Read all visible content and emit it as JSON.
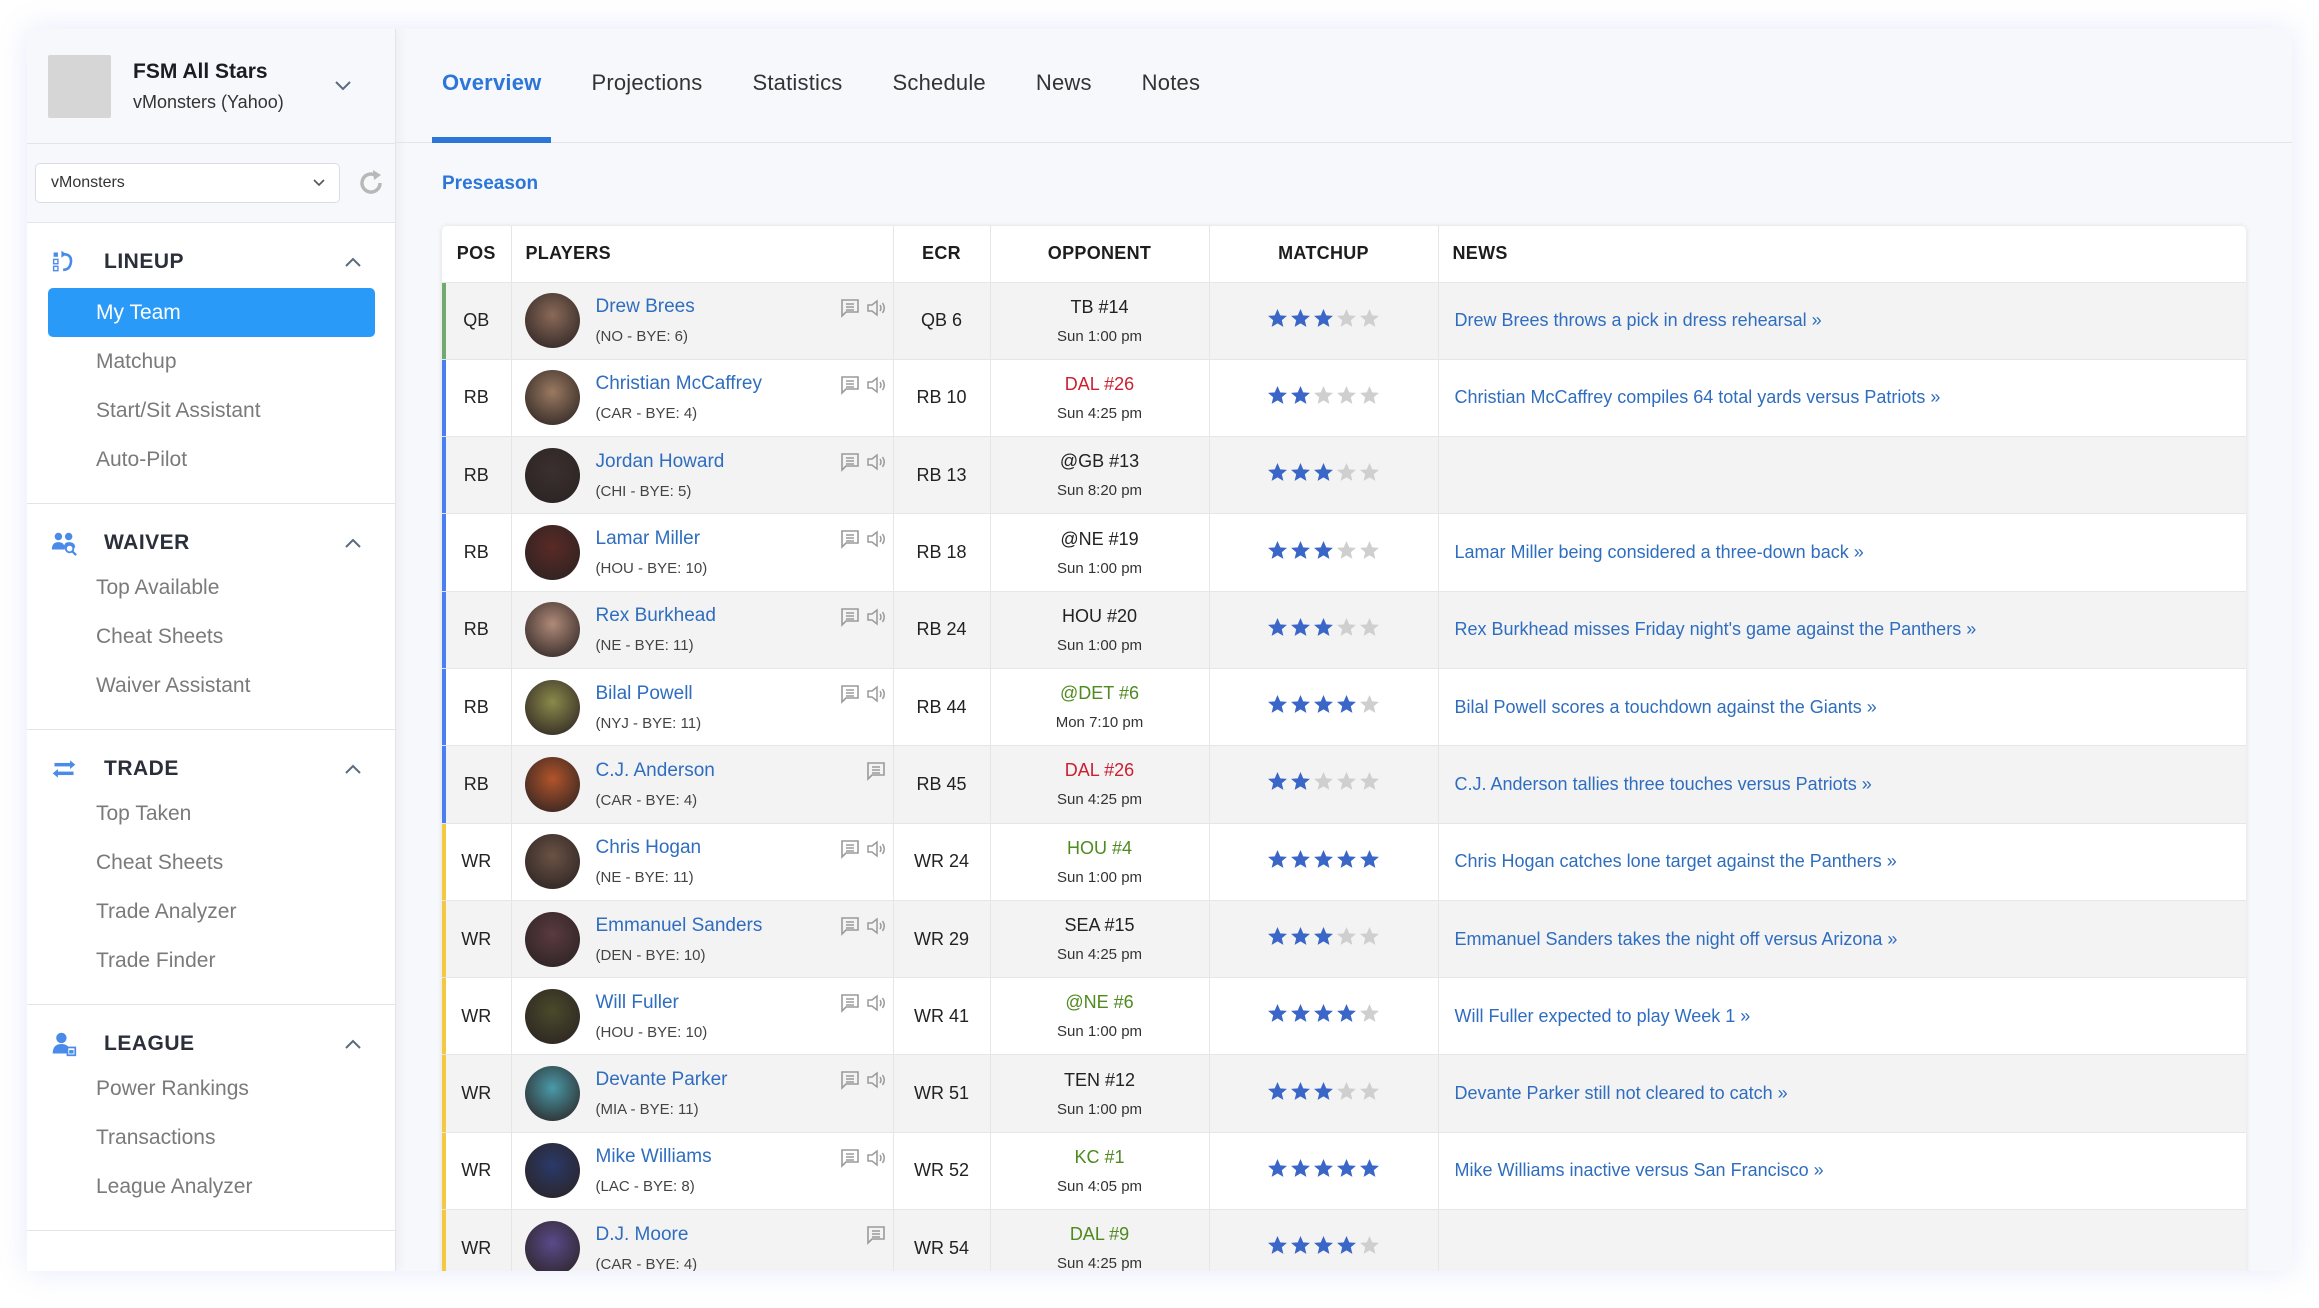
{
  "team": {
    "name": "FSM All Stars",
    "subtitle": "vMonsters (Yahoo)",
    "league_select": "vMonsters"
  },
  "sidebar": {
    "sections": [
      {
        "key": "lineup",
        "label": "LINEUP",
        "icon": "lineup-swap-icon",
        "items": [
          {
            "label": "My Team",
            "active": true
          },
          {
            "label": "Matchup"
          },
          {
            "label": "Start/Sit Assistant"
          },
          {
            "label": "Auto-Pilot"
          }
        ]
      },
      {
        "key": "waiver",
        "label": "WAIVER",
        "icon": "users-search-icon",
        "items": [
          {
            "label": "Top Available"
          },
          {
            "label": "Cheat Sheets"
          },
          {
            "label": "Waiver Assistant"
          }
        ]
      },
      {
        "key": "trade",
        "label": "TRADE",
        "icon": "trade-arrows-icon",
        "items": [
          {
            "label": "Top Taken"
          },
          {
            "label": "Cheat Sheets"
          },
          {
            "label": "Trade Analyzer"
          },
          {
            "label": "Trade Finder"
          }
        ]
      },
      {
        "key": "league",
        "label": "LEAGUE",
        "icon": "league-user-icon",
        "items": [
          {
            "label": "Power Rankings"
          },
          {
            "label": "Transactions"
          },
          {
            "label": "League Analyzer"
          }
        ]
      }
    ]
  },
  "tabs": [
    {
      "label": "Overview",
      "active": true
    },
    {
      "label": "Projections"
    },
    {
      "label": "Statistics"
    },
    {
      "label": "Schedule"
    },
    {
      "label": "News"
    },
    {
      "label": "Notes"
    }
  ],
  "section_label": "Preseason",
  "colors": {
    "accent": "#2b76d8",
    "active_nav": "#2a9af8",
    "link": "#2f6dbf",
    "star_on": "#3a66c8",
    "star_off": "#cfcfcf",
    "opp_good": "#4f8a1f",
    "opp_bad": "#cc1f2f",
    "opp_neutral": "#222222",
    "pos_QB": "#72a96c",
    "pos_RB": "#4a7ef5",
    "pos_WR": "#f5c842"
  },
  "table": {
    "headers": {
      "pos": "POS",
      "players": "PLAYERS",
      "ecr": "ECR",
      "opponent": "OPPONENT",
      "matchup": "MATCHUP",
      "news": "NEWS"
    },
    "rows": [
      {
        "pos": "QB",
        "name": "Drew Brees",
        "meta": "(NO - BYE: 6)",
        "note": true,
        "audio": true,
        "ecr": "QB 6",
        "opp": "TB #14",
        "opp_tone": "neutral",
        "time": "Sun 1:00 pm",
        "stars": 3,
        "news": "Drew Brees throws a pick in dress rehearsal »",
        "avatar_color": "#8a6a58"
      },
      {
        "pos": "RB",
        "name": "Christian McCaffrey",
        "meta": "(CAR - BYE: 4)",
        "note": true,
        "audio": true,
        "ecr": "RB 10",
        "opp": "DAL #26",
        "opp_tone": "bad",
        "time": "Sun 4:25 pm",
        "stars": 2,
        "news": "Christian McCaffrey compiles 64 total yards versus Patriots »",
        "avatar_color": "#9a7a60"
      },
      {
        "pos": "RB",
        "name": "Jordan Howard",
        "meta": "(CHI - BYE: 5)",
        "note": true,
        "audio": true,
        "ecr": "RB 13",
        "opp": "@GB #13",
        "opp_tone": "neutral",
        "time": "Sun 8:20 pm",
        "stars": 3,
        "news": "",
        "avatar_color": "#3b3030"
      },
      {
        "pos": "RB",
        "name": "Lamar Miller",
        "meta": "(HOU - BYE: 10)",
        "note": true,
        "audio": true,
        "ecr": "RB 18",
        "opp": "@NE #19",
        "opp_tone": "neutral",
        "time": "Sun 1:00 pm",
        "stars": 3,
        "news": "Lamar Miller being considered a three-down back »",
        "avatar_color": "#5a2a25"
      },
      {
        "pos": "RB",
        "name": "Rex Burkhead",
        "meta": "(NE - BYE: 11)",
        "note": true,
        "audio": true,
        "ecr": "RB 24",
        "opp": "HOU #20",
        "opp_tone": "neutral",
        "time": "Sun 1:00 pm",
        "stars": 3,
        "news": "Rex Burkhead misses Friday night's game against the Panthers »",
        "avatar_color": "#b08a78"
      },
      {
        "pos": "RB",
        "name": "Bilal Powell",
        "meta": "(NYJ - BYE: 11)",
        "note": true,
        "audio": true,
        "ecr": "RB 44",
        "opp": "@DET #6",
        "opp_tone": "good",
        "time": "Mon 7:10 pm",
        "stars": 4,
        "news": "Bilal Powell scores a touchdown against the Giants »",
        "avatar_color": "#8b8a4a"
      },
      {
        "pos": "RB",
        "name": "C.J. Anderson",
        "meta": "(CAR - BYE: 4)",
        "note": true,
        "audio": false,
        "ecr": "RB 45",
        "opp": "DAL #26",
        "opp_tone": "bad",
        "time": "Sun 4:25 pm",
        "stars": 2,
        "news": "C.J. Anderson tallies three touches versus Patriots »",
        "avatar_color": "#b2542a"
      },
      {
        "pos": "WR",
        "name": "Chris Hogan",
        "meta": "(NE - BYE: 11)",
        "note": true,
        "audio": true,
        "ecr": "WR 24",
        "opp": "HOU #4",
        "opp_tone": "good",
        "time": "Sun 1:00 pm",
        "stars": 5,
        "news": "Chris Hogan catches lone target against the Panthers »",
        "avatar_color": "#6a5244"
      },
      {
        "pos": "WR",
        "name": "Emmanuel Sanders",
        "meta": "(DEN - BYE: 10)",
        "note": true,
        "audio": true,
        "ecr": "WR 29",
        "opp": "SEA #15",
        "opp_tone": "neutral",
        "time": "Sun 4:25 pm",
        "stars": 3,
        "news": "Emmanuel Sanders takes the night off versus Arizona »",
        "avatar_color": "#5a3a40"
      },
      {
        "pos": "WR",
        "name": "Will Fuller",
        "meta": "(HOU - BYE: 10)",
        "note": true,
        "audio": true,
        "ecr": "WR 41",
        "opp": "@NE #6",
        "opp_tone": "good",
        "time": "Sun 1:00 pm",
        "stars": 4,
        "news": "Will Fuller expected to play Week 1 »",
        "avatar_color": "#4a4a2a"
      },
      {
        "pos": "WR",
        "name": "Devante Parker",
        "meta": "(MIA - BYE: 11)",
        "note": true,
        "audio": true,
        "ecr": "WR 51",
        "opp": "TEN #12",
        "opp_tone": "neutral",
        "time": "Sun 1:00 pm",
        "stars": 3,
        "news": "Devante Parker still not cleared to catch »",
        "avatar_color": "#4a9aa8"
      },
      {
        "pos": "WR",
        "name": "Mike Williams",
        "meta": "(LAC - BYE: 8)",
        "note": true,
        "audio": true,
        "ecr": "WR 52",
        "opp": "KC #1",
        "opp_tone": "good",
        "time": "Sun 4:05 pm",
        "stars": 5,
        "news": "Mike Williams inactive versus San Francisco »",
        "avatar_color": "#2a3a6a"
      },
      {
        "pos": "WR",
        "name": "D.J. Moore",
        "meta": "(CAR - BYE: 4)",
        "note": true,
        "audio": false,
        "ecr": "WR 54",
        "opp": "DAL #9",
        "opp_tone": "good",
        "time": "Sun 4:25 pm",
        "stars": 4,
        "news": "",
        "avatar_color": "#5a4a8a"
      }
    ]
  }
}
